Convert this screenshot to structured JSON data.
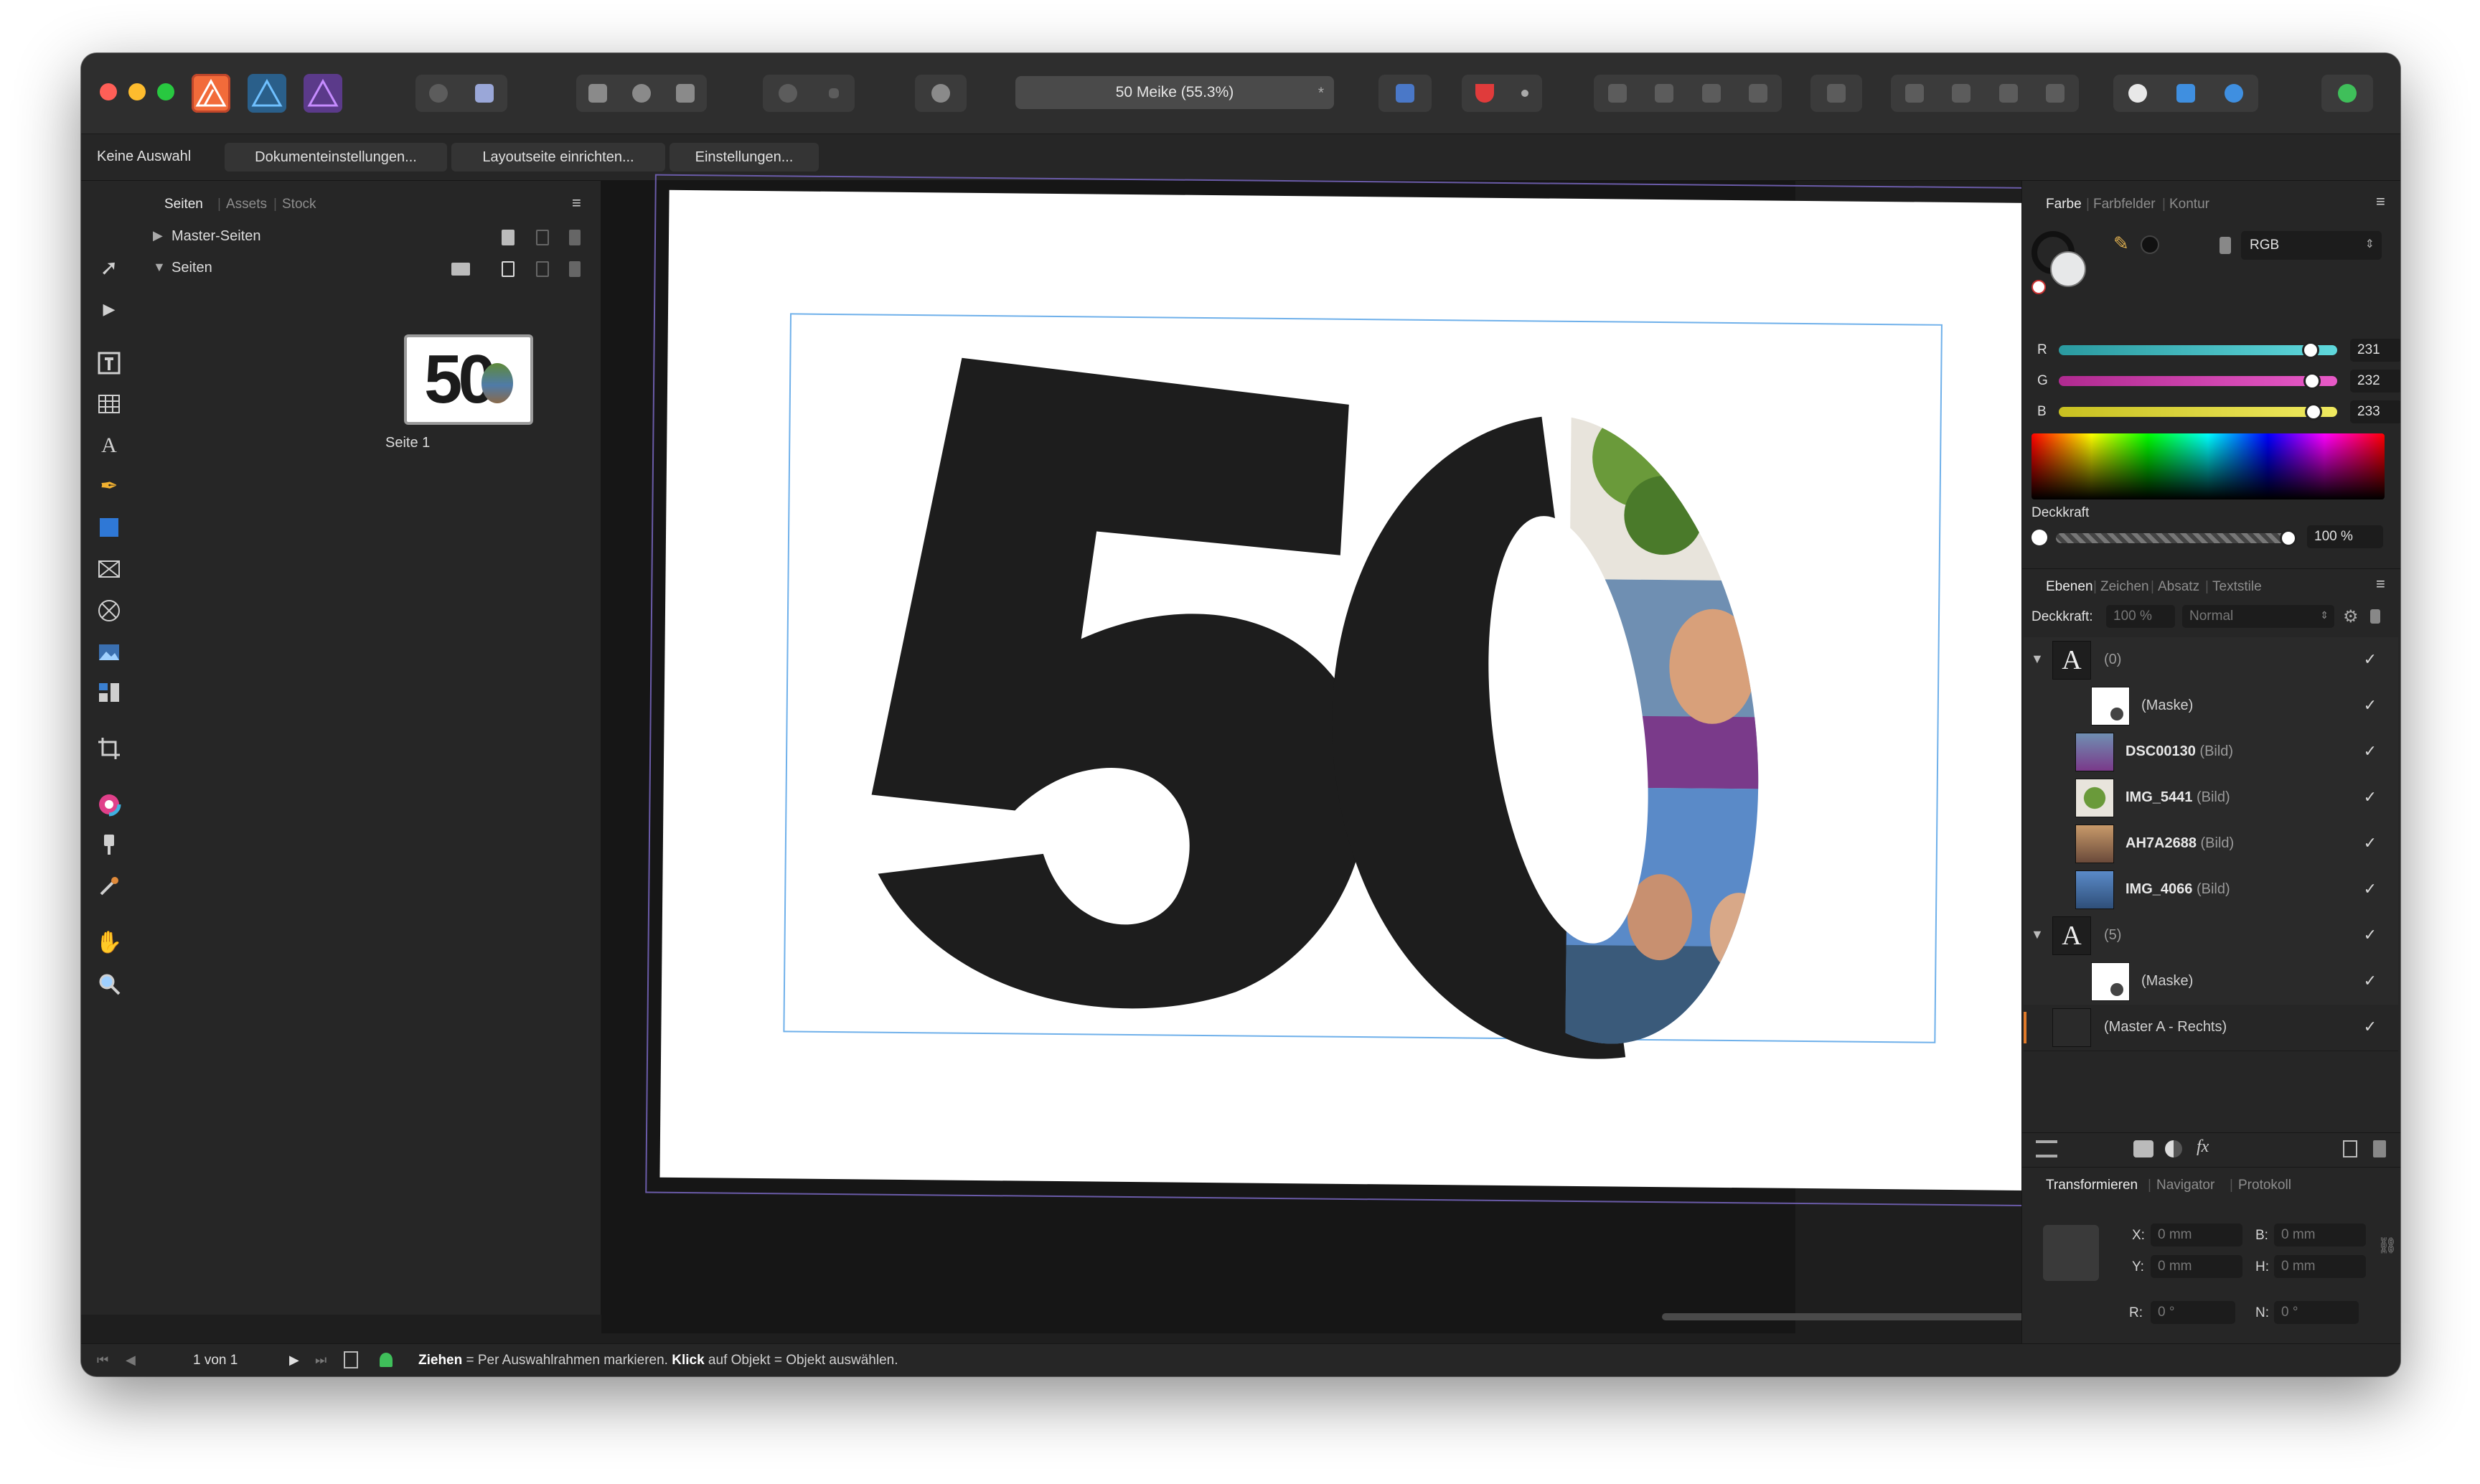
{
  "window": {
    "title": "50 Meike (55.3%)",
    "title_modified_mark": "*"
  },
  "context_toolbar": {
    "selection_status": "Keine Auswahl",
    "buttons": [
      "Dokumenteinstellungen...",
      "Layoutseite einrichten...",
      "Einstellungen..."
    ]
  },
  "pages_panel": {
    "tabs": [
      "Seiten",
      "Assets",
      "Stock"
    ],
    "active_tab": "Seiten",
    "groups": [
      "Master-Seiten",
      "Seiten"
    ],
    "pages": [
      {
        "label": "Seite 1",
        "thumb_text": "50"
      }
    ]
  },
  "canvas": {
    "artwork_text": "50"
  },
  "color_panel": {
    "tabs": [
      "Farbe",
      "Farbfelder",
      "Kontur"
    ],
    "active_tab": "Farbe",
    "mode": "RGB",
    "channels": [
      {
        "label": "R",
        "value": "231",
        "level": 231,
        "color": "#44c4c9"
      },
      {
        "label": "G",
        "value": "232",
        "level": 232,
        "color": "#c93fa8"
      },
      {
        "label": "B",
        "value": "233",
        "level": 233,
        "color": "#d8d12e"
      }
    ],
    "opacity_label": "Deckkraft",
    "opacity_value": "100 %"
  },
  "layers_panel": {
    "tabs": [
      "Ebenen",
      "Zeichen",
      "Absatz",
      "Textstile"
    ],
    "active_tab": "Ebenen",
    "opacity_label": "Deckkraft:",
    "opacity_value": "100 %",
    "blend_mode": "Normal",
    "layers": [
      {
        "icon": "A",
        "name": "",
        "kind": "(0)",
        "indent": 0,
        "expandable": true
      },
      {
        "icon": "mask",
        "name": "",
        "kind": "(Maske)",
        "indent": 1,
        "expandable": false
      },
      {
        "icon": "photo",
        "name": "DSC00130",
        "kind": "(Bild)",
        "indent": 1,
        "expandable": false,
        "thumb": "#3b6e93"
      },
      {
        "icon": "photo",
        "name": "IMG_5441",
        "kind": "(Bild)",
        "indent": 1,
        "expandable": false,
        "thumb": "#6e8f3a"
      },
      {
        "icon": "photo",
        "name": "AH7A2688",
        "kind": "(Bild)",
        "indent": 1,
        "expandable": false,
        "thumb": "#8b5a3a"
      },
      {
        "icon": "photo",
        "name": "IMG_4066",
        "kind": "(Bild)",
        "indent": 1,
        "expandable": false,
        "thumb": "#2f4f79"
      },
      {
        "icon": "A",
        "name": "",
        "kind": "(5)",
        "indent": 0,
        "expandable": true
      },
      {
        "icon": "mask",
        "name": "",
        "kind": "(Maske)",
        "indent": 1,
        "expandable": false
      },
      {
        "icon": "master",
        "name": "",
        "kind": "(Master A - Rechts)",
        "indent": 0,
        "expandable": false
      }
    ],
    "check_mark": "✓"
  },
  "transform_panel": {
    "tabs": [
      "Transformieren",
      "Navigator",
      "Protokoll"
    ],
    "active_tab": "Transformieren",
    "fields": [
      {
        "label": "X:",
        "value": "0 mm"
      },
      {
        "label": "B:",
        "value": "0 mm"
      },
      {
        "label": "Y:",
        "value": "0 mm"
      },
      {
        "label": "H:",
        "value": "0 mm"
      },
      {
        "label": "R:",
        "value": "0 °"
      },
      {
        "label": "N:",
        "value": "0 °"
      }
    ]
  },
  "status_bar": {
    "page_indicator": "1 von 1",
    "hint_strong_1": "Ziehen",
    "hint_text_1": " = Per Auswahlrahmen markieren. ",
    "hint_strong_2": "Klick",
    "hint_text_2": " auf Objekt = Objekt auswählen."
  },
  "colors": {
    "accent_blue": "#3e8ed8",
    "page_outline": "#6a5ba8",
    "panel_bg": "#262626"
  }
}
